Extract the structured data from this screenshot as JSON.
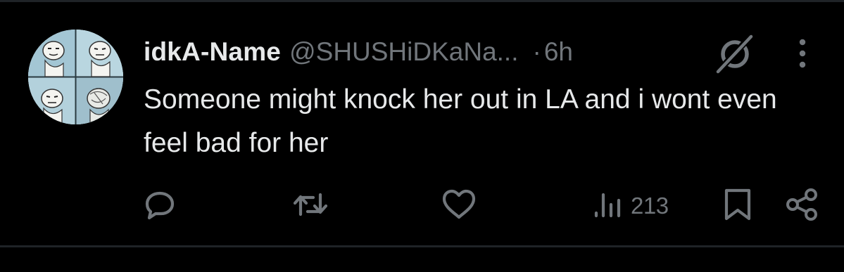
{
  "tweet": {
    "author": {
      "display_name": "idkA-Name",
      "handle": "@SHUSHiDKaNa...",
      "avatar": "avatar-image"
    },
    "separator": "·",
    "time": "6h",
    "text": "Someone might knock her out in LA and i wont even feel bad for her",
    "header_icons": [
      "grok-icon",
      "more-options-icon"
    ],
    "actions": [
      {
        "name": "reply",
        "icon": "reply-icon"
      },
      {
        "name": "repost",
        "icon": "repost-icon"
      },
      {
        "name": "like",
        "icon": "heart-icon"
      },
      {
        "name": "views",
        "icon": "views-icon",
        "count": "213"
      },
      {
        "name": "bookmark",
        "icon": "bookmark-icon"
      },
      {
        "name": "share",
        "icon": "share-icon"
      }
    ]
  },
  "colors": {
    "background": "#000000",
    "primary_text": "#e7e9ea",
    "secondary_text": "#71767b",
    "divider": "#1f2327"
  }
}
